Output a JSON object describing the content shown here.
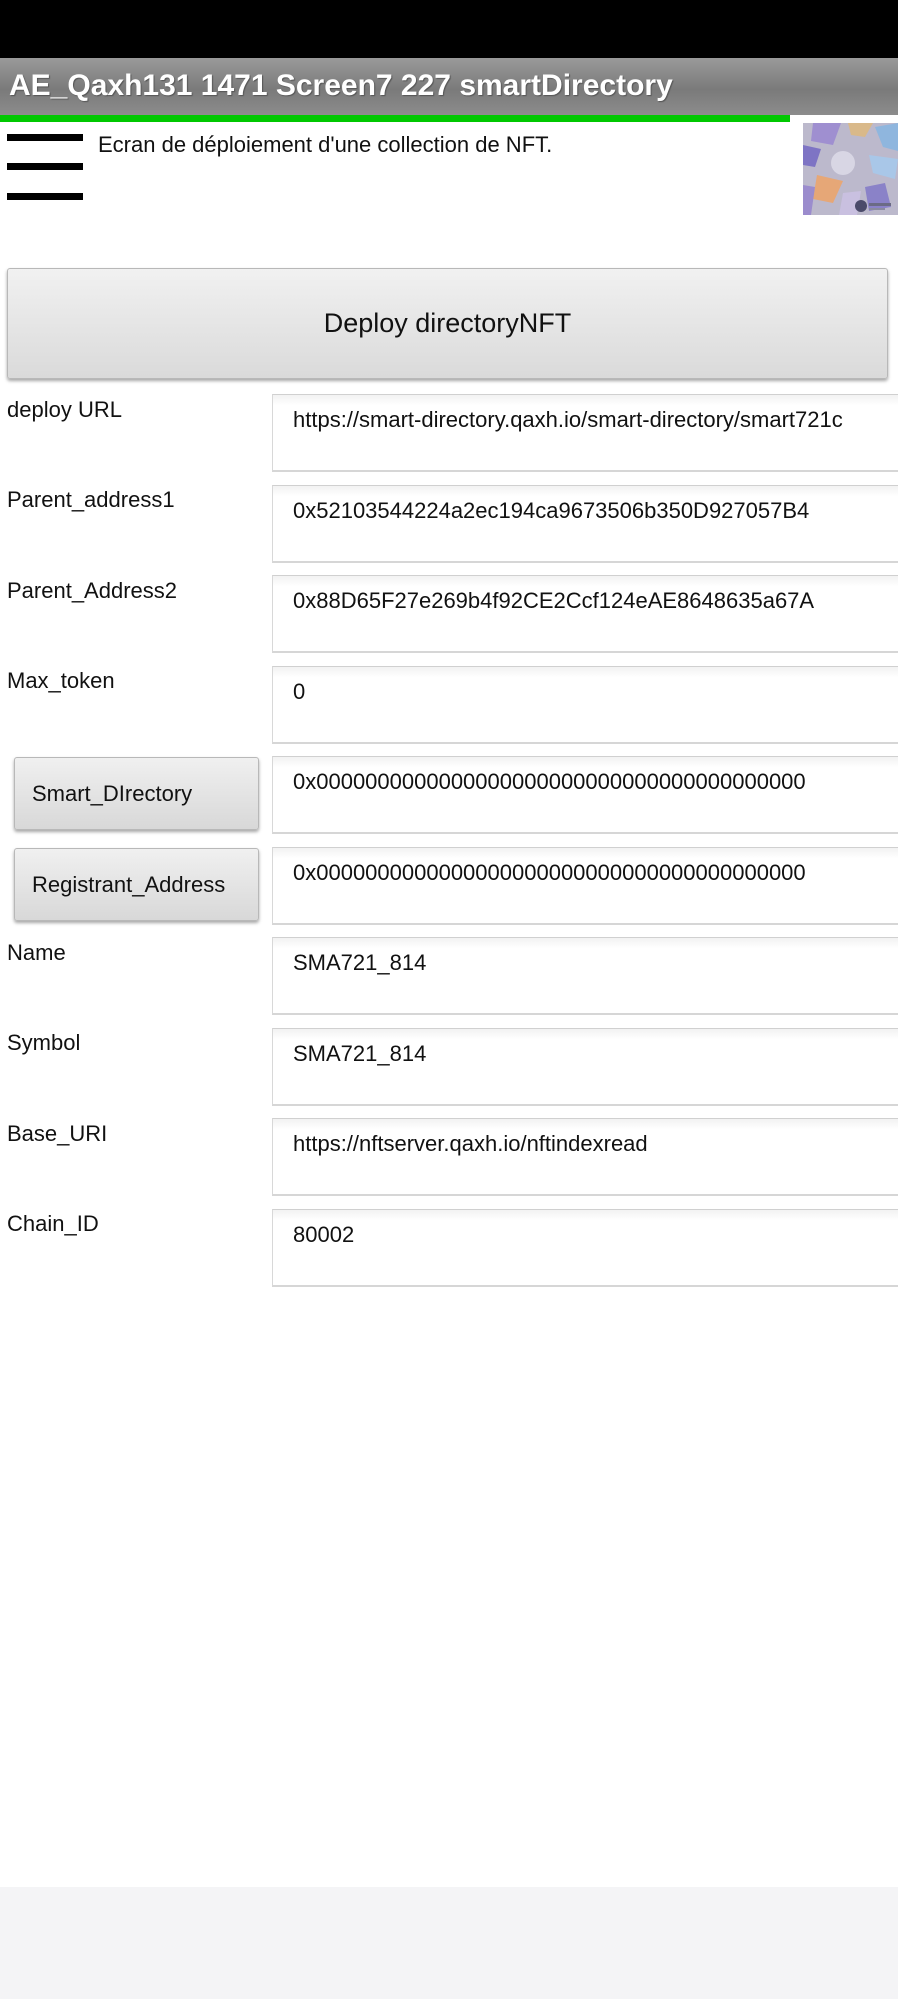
{
  "app": {
    "title": "AE_Qaxh131 1471 Screen7 227 smartDirectory",
    "subtitle": "Ecran de déploiement d'une collection de NFT.",
    "progress": 0.88
  },
  "icons": {
    "menu": "hamburger-menu-icon",
    "logo": "smart-directory-logo"
  },
  "colors": {
    "title_bar": "#8a8a8a",
    "progress": "#00c800",
    "status_bar": "#000000"
  },
  "deploy_button": {
    "label": "Deploy directoryNFT"
  },
  "fields": {
    "deploy_url": {
      "label": "deploy URL",
      "value": "https://smart-directory.qaxh.io/smart-directory/smart721c"
    },
    "parent_address1": {
      "label": "Parent_address1",
      "value": "0x52103544224a2ec194ca9673506b350D927057B4"
    },
    "parent_address2": {
      "label": "Parent_Address2",
      "value": "0x88D65F27e269b4f92CE2Ccf124eAE8648635a67A"
    },
    "max_token": {
      "label": "Max_token",
      "value": "0"
    },
    "smart_directory": {
      "button_label": "Smart_DIrectory",
      "value": "0x0000000000000000000000000000000000000000"
    },
    "registrant_address": {
      "button_label": "Registrant_Address",
      "value": "0x0000000000000000000000000000000000000000"
    },
    "name": {
      "label": "Name",
      "value": "SMA721_814"
    },
    "symbol": {
      "label": "Symbol",
      "value": "SMA721_814"
    },
    "base_uri": {
      "label": "Base_URI",
      "value": "https://nftserver.qaxh.io/nftindexread"
    },
    "chain_id": {
      "label": "Chain_ID",
      "value": "80002"
    }
  }
}
